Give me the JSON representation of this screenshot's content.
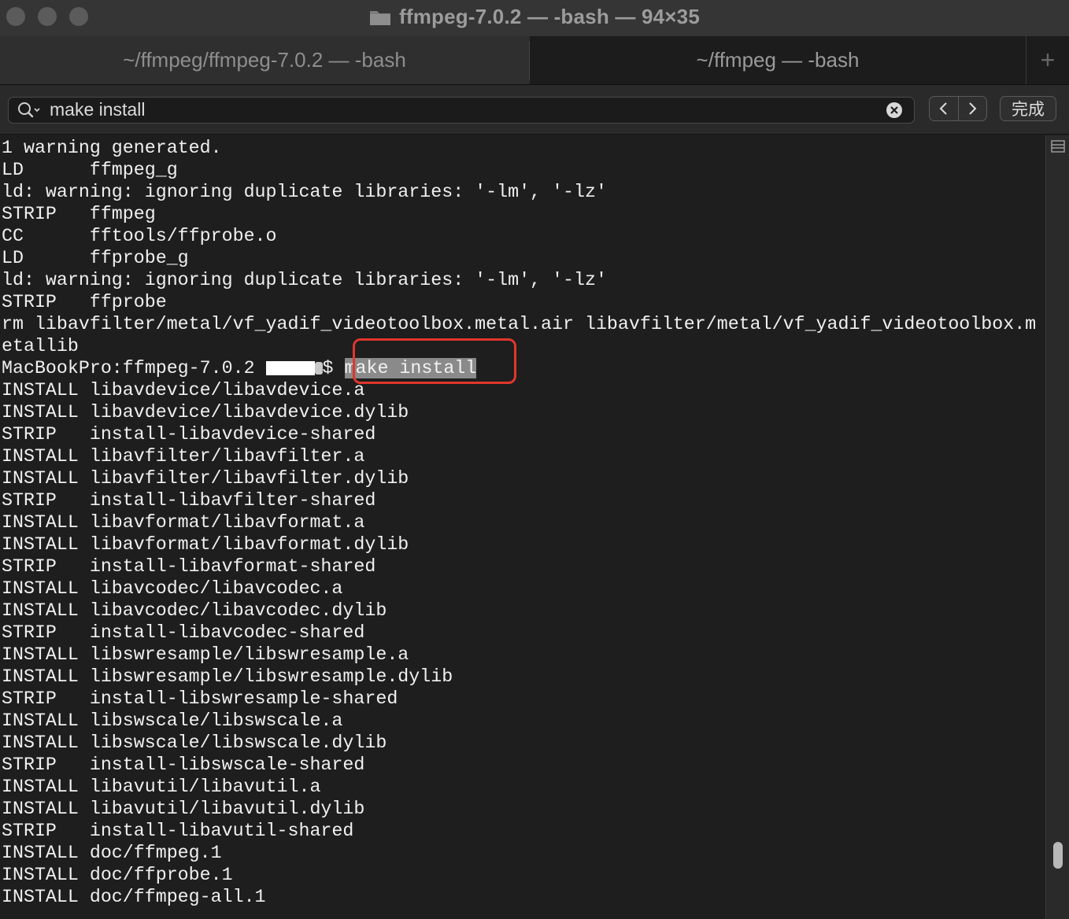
{
  "window": {
    "title": "ffmpeg-7.0.2 — -bash — 94×35"
  },
  "tabs": [
    {
      "label": "~/ffmpeg/ffmpeg-7.0.2 — -bash"
    },
    {
      "label": "~/ffmpeg — -bash"
    }
  ],
  "new_tab": {
    "label": "+"
  },
  "find": {
    "query": "make install",
    "done_label": "完成"
  },
  "terminal": {
    "lines": [
      "1 warning generated.",
      "LD      ffmpeg_g",
      "ld: warning: ignoring duplicate libraries: '-lm', '-lz'",
      "STRIP   ffmpeg",
      "CC      fftools/ffprobe.o",
      "LD      ffprobe_g",
      "ld: warning: ignoring duplicate libraries: '-lm', '-lz'",
      "STRIP   ffprobe",
      "rm libavfilter/metal/vf_yadif_videotoolbox.metal.air libavfilter/metal/vf_yadif_videotoolbox.m",
      "etallib",
      "",
      "INSTALL libavdevice/libavdevice.a",
      "INSTALL libavdevice/libavdevice.dylib",
      "STRIP   install-libavdevice-shared",
      "INSTALL libavfilter/libavfilter.a",
      "INSTALL libavfilter/libavfilter.dylib",
      "STRIP   install-libavfilter-shared",
      "INSTALL libavformat/libavformat.a",
      "INSTALL libavformat/libavformat.dylib",
      "STRIP   install-libavformat-shared",
      "INSTALL libavcodec/libavcodec.a",
      "INSTALL libavcodec/libavcodec.dylib",
      "STRIP   install-libavcodec-shared",
      "INSTALL libswresample/libswresample.a",
      "INSTALL libswresample/libswresample.dylib",
      "STRIP   install-libswresample-shared",
      "INSTALL libswscale/libswscale.a",
      "INSTALL libswscale/libswscale.dylib",
      "STRIP   install-libswscale-shared",
      "INSTALL libavutil/libavutil.a",
      "INSTALL libavutil/libavutil.dylib",
      "STRIP   install-libavutil-shared",
      "INSTALL doc/ffmpeg.1",
      "INSTALL doc/ffprobe.1",
      "INSTALL doc/ffmpeg-all.1"
    ],
    "prompt": {
      "host_path": "MacBookPro:ffmpeg-7.0.2 ",
      "suffix": "$ ",
      "command": "make install"
    }
  },
  "colors": {
    "background": "#1e1e1e",
    "text": "#f0f0f0",
    "highlight": "#8a8a8a",
    "callout": "#e0362c"
  }
}
